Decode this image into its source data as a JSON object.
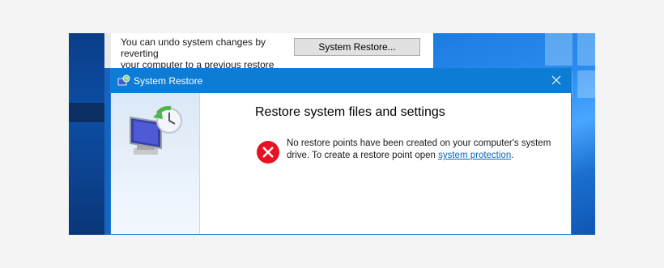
{
  "background_panel": {
    "description_line1": "You can undo system changes by reverting",
    "description_line2": "your computer to a previous restore point.",
    "system_restore_button_label": "System Restore..."
  },
  "dialog": {
    "title": "System Restore",
    "heading": "Restore system files and settings",
    "message_prefix": "No restore points have been created on your computer's system drive. To create a restore point open ",
    "link_text": "system protection",
    "message_suffix": ".",
    "title_icon": "system-restore-icon",
    "sidebar_art_icon": "system-restore-clock-monitor-icon",
    "error_icon": "error-x-icon"
  },
  "colors": {
    "titlebar": "#0c7cd5",
    "error_red": "#e81123",
    "link": "#0a63c4",
    "desktop_blue": "#1565c0"
  }
}
